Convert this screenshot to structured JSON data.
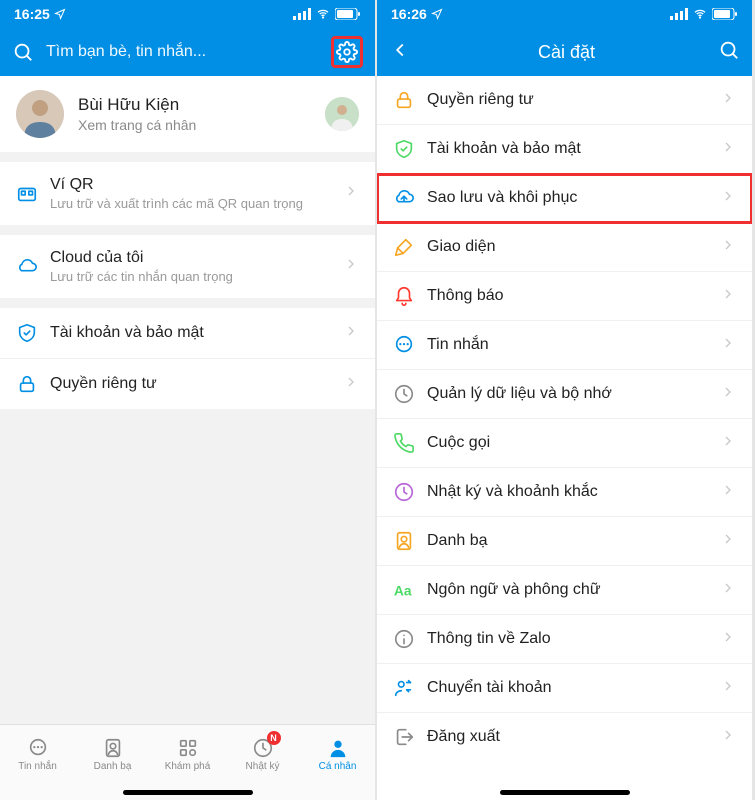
{
  "left": {
    "time": "16:25",
    "search_placeholder": "Tìm bạn bè, tin nhắn...",
    "profile": {
      "name": "Bùi Hữu Kiện",
      "subtitle": "Xem trang cá nhân"
    },
    "group1": [
      {
        "icon": "qr-wallet",
        "color": "#008fe5",
        "title": "Ví QR",
        "sub": "Lưu trữ và xuất trình các mã QR quan trọng"
      }
    ],
    "group2": [
      {
        "icon": "cloud",
        "color": "#008fe5",
        "title": "Cloud của tôi",
        "sub": "Lưu trữ các tin nhắn quan trọng"
      }
    ],
    "group3": [
      {
        "icon": "shield",
        "color": "#008fe5",
        "title": "Tài khoản và bảo mật",
        "sub": ""
      },
      {
        "icon": "lock",
        "color": "#008fe5",
        "title": "Quyền riêng tư",
        "sub": ""
      }
    ],
    "tabs": [
      {
        "label": "Tin nhắn",
        "icon": "message",
        "active": false,
        "badge": ""
      },
      {
        "label": "Danh bạ",
        "icon": "contacts",
        "active": false,
        "badge": ""
      },
      {
        "label": "Khám phá",
        "icon": "explore",
        "active": false,
        "badge": ""
      },
      {
        "label": "Nhật ký",
        "icon": "diary",
        "active": false,
        "badge": "N"
      },
      {
        "label": "Cá nhân",
        "icon": "person",
        "active": true,
        "badge": ""
      }
    ]
  },
  "right": {
    "time": "16:26",
    "title": "Cài đặt",
    "items": [
      {
        "icon": "lock",
        "color": "#f5a623",
        "title": "Quyền riêng tư"
      },
      {
        "icon": "shield",
        "color": "#4cd964",
        "title": "Tài khoản và bảo mật"
      },
      {
        "icon": "cloud-backup",
        "color": "#008fe5",
        "title": "Sao lưu và khôi phục",
        "highlighted": true
      },
      {
        "icon": "brush",
        "color": "#f5a623",
        "title": "Giao diện"
      },
      {
        "icon": "bell",
        "color": "#ff3b30",
        "title": "Thông báo"
      },
      {
        "icon": "message",
        "color": "#008fe5",
        "title": "Tin nhắn"
      },
      {
        "icon": "storage",
        "color": "#8a8a8a",
        "title": "Quản lý dữ liệu và bộ nhớ"
      },
      {
        "icon": "phone",
        "color": "#4cd964",
        "title": "Cuộc gọi"
      },
      {
        "icon": "clock",
        "color": "#b565d8",
        "title": "Nhật ký và khoảnh khắc"
      },
      {
        "icon": "contacts",
        "color": "#f5a623",
        "title": "Danh bạ"
      },
      {
        "icon": "font",
        "color": "#4cd964",
        "title": "Ngôn ngữ và phông chữ"
      },
      {
        "icon": "info",
        "color": "#8a8a8a",
        "title": "Thông tin về Zalo"
      },
      {
        "icon": "switch-account",
        "color": "#008fe5",
        "title": "Chuyển tài khoản"
      },
      {
        "icon": "logout",
        "color": "#8a8a8a",
        "title": "Đăng xuất"
      }
    ]
  }
}
